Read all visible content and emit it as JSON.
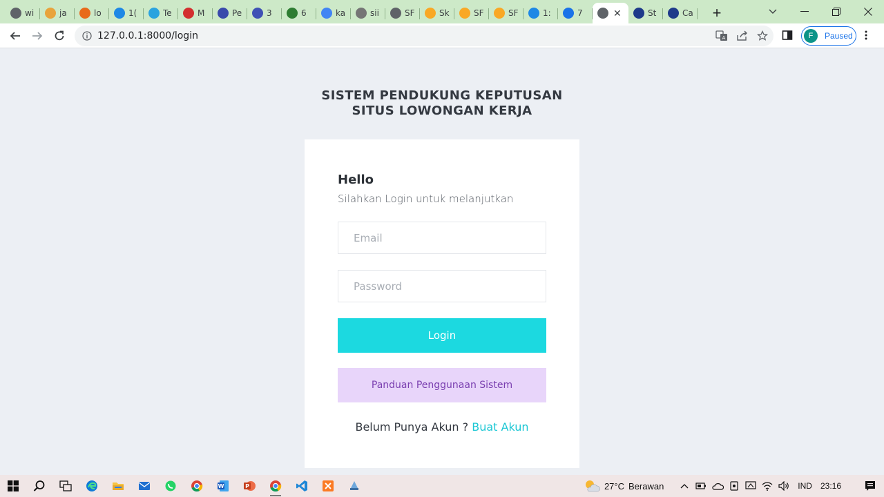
{
  "browser": {
    "tabs": [
      {
        "title": "wi",
        "icon": "edge-icon",
        "color": "#5f6368"
      },
      {
        "title": "ja",
        "icon": "java-icon",
        "color": "#e8a33c"
      },
      {
        "title": "lo",
        "icon": "pma-icon",
        "color": "#e86a1a"
      },
      {
        "title": "1(",
        "icon": "dots-icon",
        "color": "#1e88e5"
      },
      {
        "title": "Te",
        "icon": "telegram-icon",
        "color": "#2aa3df"
      },
      {
        "title": "M",
        "icon": "r-icon",
        "color": "#d32f2f"
      },
      {
        "title": "Pe",
        "icon": "chat-icon",
        "color": "#3949ab"
      },
      {
        "title": "3",
        "icon": "d-icon",
        "color": "#3f51b5"
      },
      {
        "title": "6",
        "icon": "map-icon",
        "color": "#2e7d32"
      },
      {
        "title": "ka",
        "icon": "google-icon",
        "color": "#4285f4"
      },
      {
        "title": "sii",
        "icon": "gear-icon",
        "color": "#757575"
      },
      {
        "title": "SF",
        "icon": "globe-icon",
        "color": "#5f6368"
      },
      {
        "title": "Sk",
        "icon": "sun-icon",
        "color": "#f9a825"
      },
      {
        "title": "SF",
        "icon": "bell-icon",
        "color": "#f9a825"
      },
      {
        "title": "SF",
        "icon": "bell-icon",
        "color": "#f9a825"
      },
      {
        "title": "1:",
        "icon": "edit-icon",
        "color": "#1e88e5"
      },
      {
        "title": "7",
        "icon": "g-icon",
        "color": "#1a73e8"
      },
      {
        "title": "",
        "icon": "globe-icon",
        "color": "#5f6368",
        "active": true
      },
      {
        "title": "St",
        "icon": "b-icon",
        "color": "#1e3a8a"
      },
      {
        "title": "Ca",
        "icon": "seal-icon",
        "color": "#1e3a8a"
      }
    ],
    "url": "127.0.0.1:8000/login",
    "profile_initial": "F",
    "profile_status": "Paused"
  },
  "page": {
    "app_title_line1": "SISTEM PENDUKUNG KEPUTUSAN",
    "app_title_line2": "SITUS LOWONGAN KERJA",
    "greeting": "Hello",
    "subtitle": "Silahkan Login untuk melanjutkan",
    "email_placeholder": "Email",
    "password_placeholder": "Password",
    "login_label": "Login",
    "guide_label": "Panduan Penggunaan Sistem",
    "signup_prompt": "Belum Punya Akun ?",
    "signup_link": "Buat Akun",
    "colors": {
      "accent": "#1cd9e0",
      "guide_bg": "#e8d5fa",
      "guide_text": "#7a3fb0",
      "link": "#1cc7d4"
    }
  },
  "taskbar": {
    "weather_temp": "27°C",
    "weather_desc": "Berawan",
    "language": "IND",
    "time": "23:16"
  }
}
